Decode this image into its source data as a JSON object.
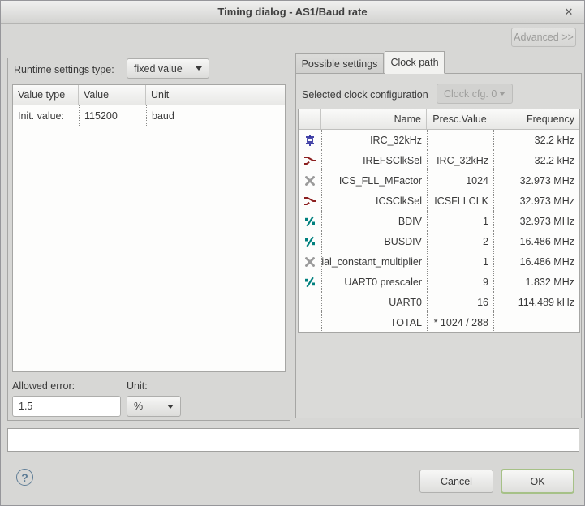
{
  "window": {
    "title": "Timing dialog - AS1/Baud rate",
    "close_glyph": "✕"
  },
  "advanced_button_label": "Advanced >>",
  "left_panel": {
    "runtime_label": "Runtime settings type:",
    "runtime_value": "fixed value",
    "table": {
      "headers": [
        "Value type",
        "Value",
        "Unit"
      ],
      "rows": [
        {
          "type": "Init. value:",
          "value": "115200",
          "unit": "baud"
        }
      ]
    },
    "allowed_error_label": "Allowed error:",
    "allowed_error_value": "1.5",
    "unit_label": "Unit:",
    "unit_value": "%"
  },
  "right_panel": {
    "tabs": [
      {
        "label": "Possible settings",
        "active": false
      },
      {
        "label": "Clock path",
        "active": true
      }
    ],
    "clock_cfg_label": "Selected clock configuration",
    "clock_cfg_value": "Clock cfg. 0",
    "table": {
      "headers": [
        "",
        "Name",
        "Presc.Value",
        "Frequency"
      ],
      "rows": [
        {
          "icon": "crystal-icon",
          "name": "IRC_32kHz",
          "presc": "",
          "freq": "32.2 kHz"
        },
        {
          "icon": "mux-icon",
          "name": "IREFSClkSel",
          "presc": "IRC_32kHz",
          "freq": "32.2 kHz"
        },
        {
          "icon": "multiply-icon",
          "name": "ICS_FLL_MFactor",
          "presc": "1024",
          "freq": "32.973 MHz"
        },
        {
          "icon": "mux-icon",
          "name": "ICSClkSel",
          "presc": "ICSFLLCLK",
          "freq": "32.973 MHz"
        },
        {
          "icon": "divide-icon",
          "name": "BDIV",
          "presc": "1",
          "freq": "32.973 MHz"
        },
        {
          "icon": "divide-icon",
          "name": "BUSDIV",
          "presc": "2",
          "freq": "16.486 MHz"
        },
        {
          "icon": "multiply-icon",
          "name": "ial_constant_multiplier",
          "presc": "1",
          "freq": "16.486 MHz"
        },
        {
          "icon": "divide-icon",
          "name": "UART0 prescaler",
          "presc": "9",
          "freq": "1.832 MHz"
        },
        {
          "icon": "",
          "name": "UART0",
          "presc": "16",
          "freq": "114.489 kHz"
        },
        {
          "icon": "",
          "name": "TOTAL",
          "presc": "* 1024 / 288",
          "freq": ""
        }
      ]
    }
  },
  "footer": {
    "message": "",
    "help_glyph": "?",
    "cancel_label": "Cancel",
    "ok_label": "OK"
  },
  "colors": {
    "ok_focus_border": "#a6c187",
    "icon_crystal": "#28289b",
    "icon_mux": "#8b1f1f",
    "icon_multiply": "#9b9b9b",
    "icon_divide": "#00807e"
  }
}
